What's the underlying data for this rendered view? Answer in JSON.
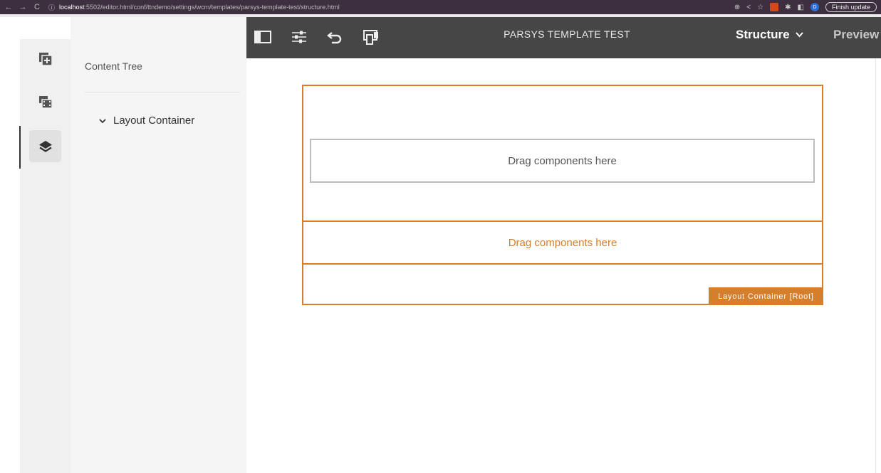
{
  "browser": {
    "nav": {
      "back": "←",
      "forward": "→",
      "reload": "C"
    },
    "url_host": "localhost",
    "url_path": ":5502/editor.html/conf/ttndemo/settings/wcm/templates/parsys-template-test/structure.html",
    "profile_initial": "D",
    "finish_update": "Finish update"
  },
  "rail": {
    "items": [
      "components-icon",
      "assets-icon",
      "content-tree-icon"
    ]
  },
  "panel": {
    "title": "Content Tree",
    "tree": [
      {
        "label": "Layout Container"
      }
    ]
  },
  "toolbar": {
    "page_title": "PARSYS TEMPLATE TEST",
    "mode": "Structure",
    "preview": "Preview"
  },
  "canvas": {
    "inner_placeholder": "Drag components here",
    "root_placeholder": "Drag components here",
    "root_label": "Layout Container [Root]"
  },
  "colors": {
    "accent": "#d57e2b",
    "toolbar_bg": "#464646",
    "browser_bg": "#3d2f3f"
  }
}
